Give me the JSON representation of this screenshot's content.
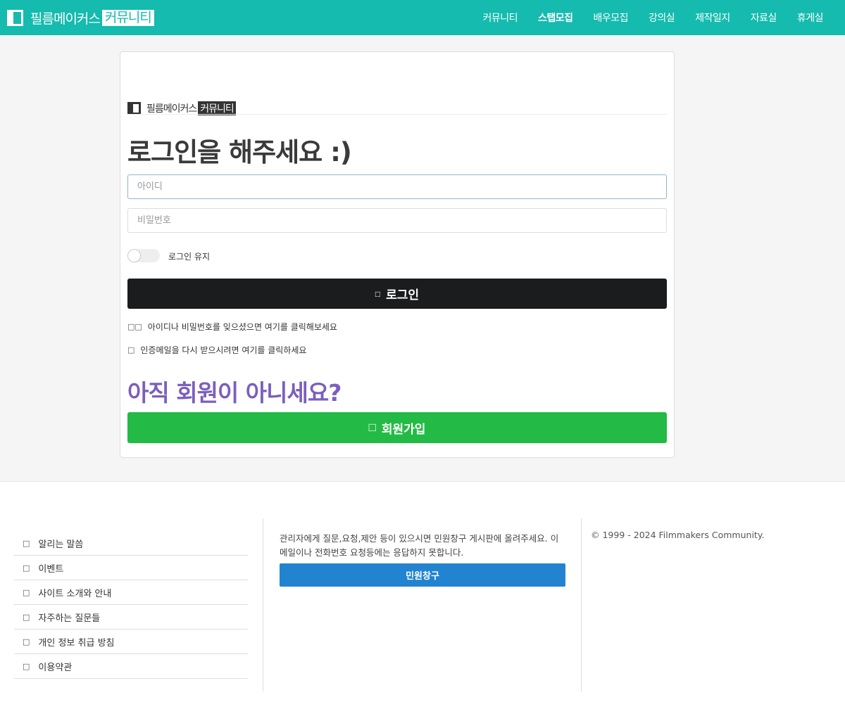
{
  "header": {
    "brand_text": "필름메이커스",
    "brand_box": "커뮤니티",
    "nav": [
      {
        "label": "커뮤니티",
        "active": false
      },
      {
        "label": "스탭모집",
        "active": true
      },
      {
        "label": "배우모집",
        "active": false
      },
      {
        "label": "강의실",
        "active": false
      },
      {
        "label": "제작일지",
        "active": false
      },
      {
        "label": "자료실",
        "active": false
      },
      {
        "label": "휴게실",
        "active": false
      }
    ]
  },
  "login": {
    "logo_text": "필름메이커스",
    "logo_box": "커뮤니티",
    "title": "로그인을 해주세요 :)",
    "id_placeholder": "아이디",
    "pw_placeholder": "비밀번호",
    "keep_login": "로그인 유지",
    "keep_login_on": false,
    "login_icon": "lock-icon",
    "login_button": "로그인",
    "find_icon": "users-icon",
    "find_text": "아이디나 비밀번호를 잊으셨으면 여기를 클릭해보세요",
    "mail_icon": "envelope-icon",
    "mail_text": "인증메일을 다시 받으시려면 여기를 클릭하세요",
    "signup_title": "아직 회원이 아니세요?",
    "signup_icon": "user-plus-icon",
    "signup_button": "회원가입"
  },
  "footer": {
    "links": [
      {
        "label": "알리는 말씀",
        "icon": "bullhorn-icon"
      },
      {
        "label": "이벤트",
        "icon": "gift-icon"
      },
      {
        "label": "사이트 소개와 안내",
        "icon": "info-icon"
      },
      {
        "label": "자주하는 질문들",
        "icon": "question-icon"
      },
      {
        "label": "개인 정보 취급 방침",
        "icon": "shield-icon"
      },
      {
        "label": "이용약관",
        "icon": "document-icon"
      }
    ],
    "notice": "관리자에게 질문,요청,제안 등이 있으시면 민원창구 게시판에 올려주세요. 이메일이나 전화번호 요청등에는 응답하지 못합니다.",
    "minwon_button": "민원창구",
    "copyright": "© 1999 - 2024 Filmmakers Community."
  },
  "colors": {
    "header": "#14bbae",
    "login_button": "#1b1c1e",
    "signup_title": "#7b5fbd",
    "signup_button": "#23bb45",
    "minwon_button": "#2283d1"
  }
}
